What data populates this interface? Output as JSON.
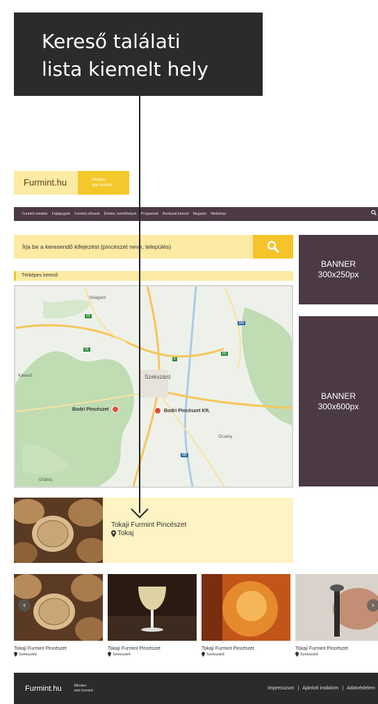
{
  "callout": {
    "line1": "Kereső találati",
    "line2": "lista kiemelt hely"
  },
  "logo": {
    "name": "Furmint.hu",
    "tagline_1": "Minden",
    "tagline_2": "ami furmint"
  },
  "nav": {
    "items": [
      "Furmint eredete",
      "Fajtajegyek",
      "Furmint stílusok",
      "Érlelés, termőhelyek",
      "Programok",
      "Borászat kereső",
      "Magazin",
      "Webshop"
    ],
    "search_icon": "search-icon"
  },
  "search": {
    "placeholder": "Írja be a keresendő kifejezést (pincészet neve, település)",
    "button_icon": "search-icon"
  },
  "map_section": {
    "label": "Térképes kereső",
    "places": {
      "sioagard": "Sióagárd",
      "kakasd": "Kakasd",
      "szekszard": "Szekszárd",
      "ocseny": "Őcsény",
      "grabocz": "Grábóc"
    },
    "roads": {
      "r63": "63",
      "r56": "56",
      "r6": "6",
      "r65": "65",
      "rm9": "M9",
      "r6a": "6",
      "rm6": "M6"
    },
    "pins": [
      "Bodri Pincészet",
      "Bodri Pincészet Kft."
    ]
  },
  "banners": [
    {
      "title": "BANNER",
      "size": "300x250px"
    },
    {
      "title": "BANNER",
      "size": "300x600px"
    }
  ],
  "featured": {
    "name": "Tokaji Furmint Pincészet",
    "location": "Tokaj"
  },
  "carousel": {
    "items": [
      {
        "name": "Tokaji Furmint Pincészet",
        "location": "Szekszárd"
      },
      {
        "name": "Tokaji Furmint Pincészet",
        "location": "Szekszárd"
      },
      {
        "name": "Tokaji Furmint Pincészet",
        "location": "Szekszárd"
      },
      {
        "name": "Tokaji Furmint Pincészet",
        "location": "Szekszárd"
      }
    ],
    "prev": "‹",
    "next": "›"
  },
  "footer": {
    "logo": "Furmint.hu",
    "tagline_1": "Minden",
    "tagline_2": "ami furmint",
    "links": [
      "Impresszum",
      "Ajánlott irodalom",
      "Adatvédelem"
    ],
    "separator": "|"
  },
  "colors": {
    "brand_yellow": "#f6c42a",
    "light_yellow": "#fdeaa3",
    "plum": "#4b3a44",
    "dark": "#2b2b2b"
  }
}
